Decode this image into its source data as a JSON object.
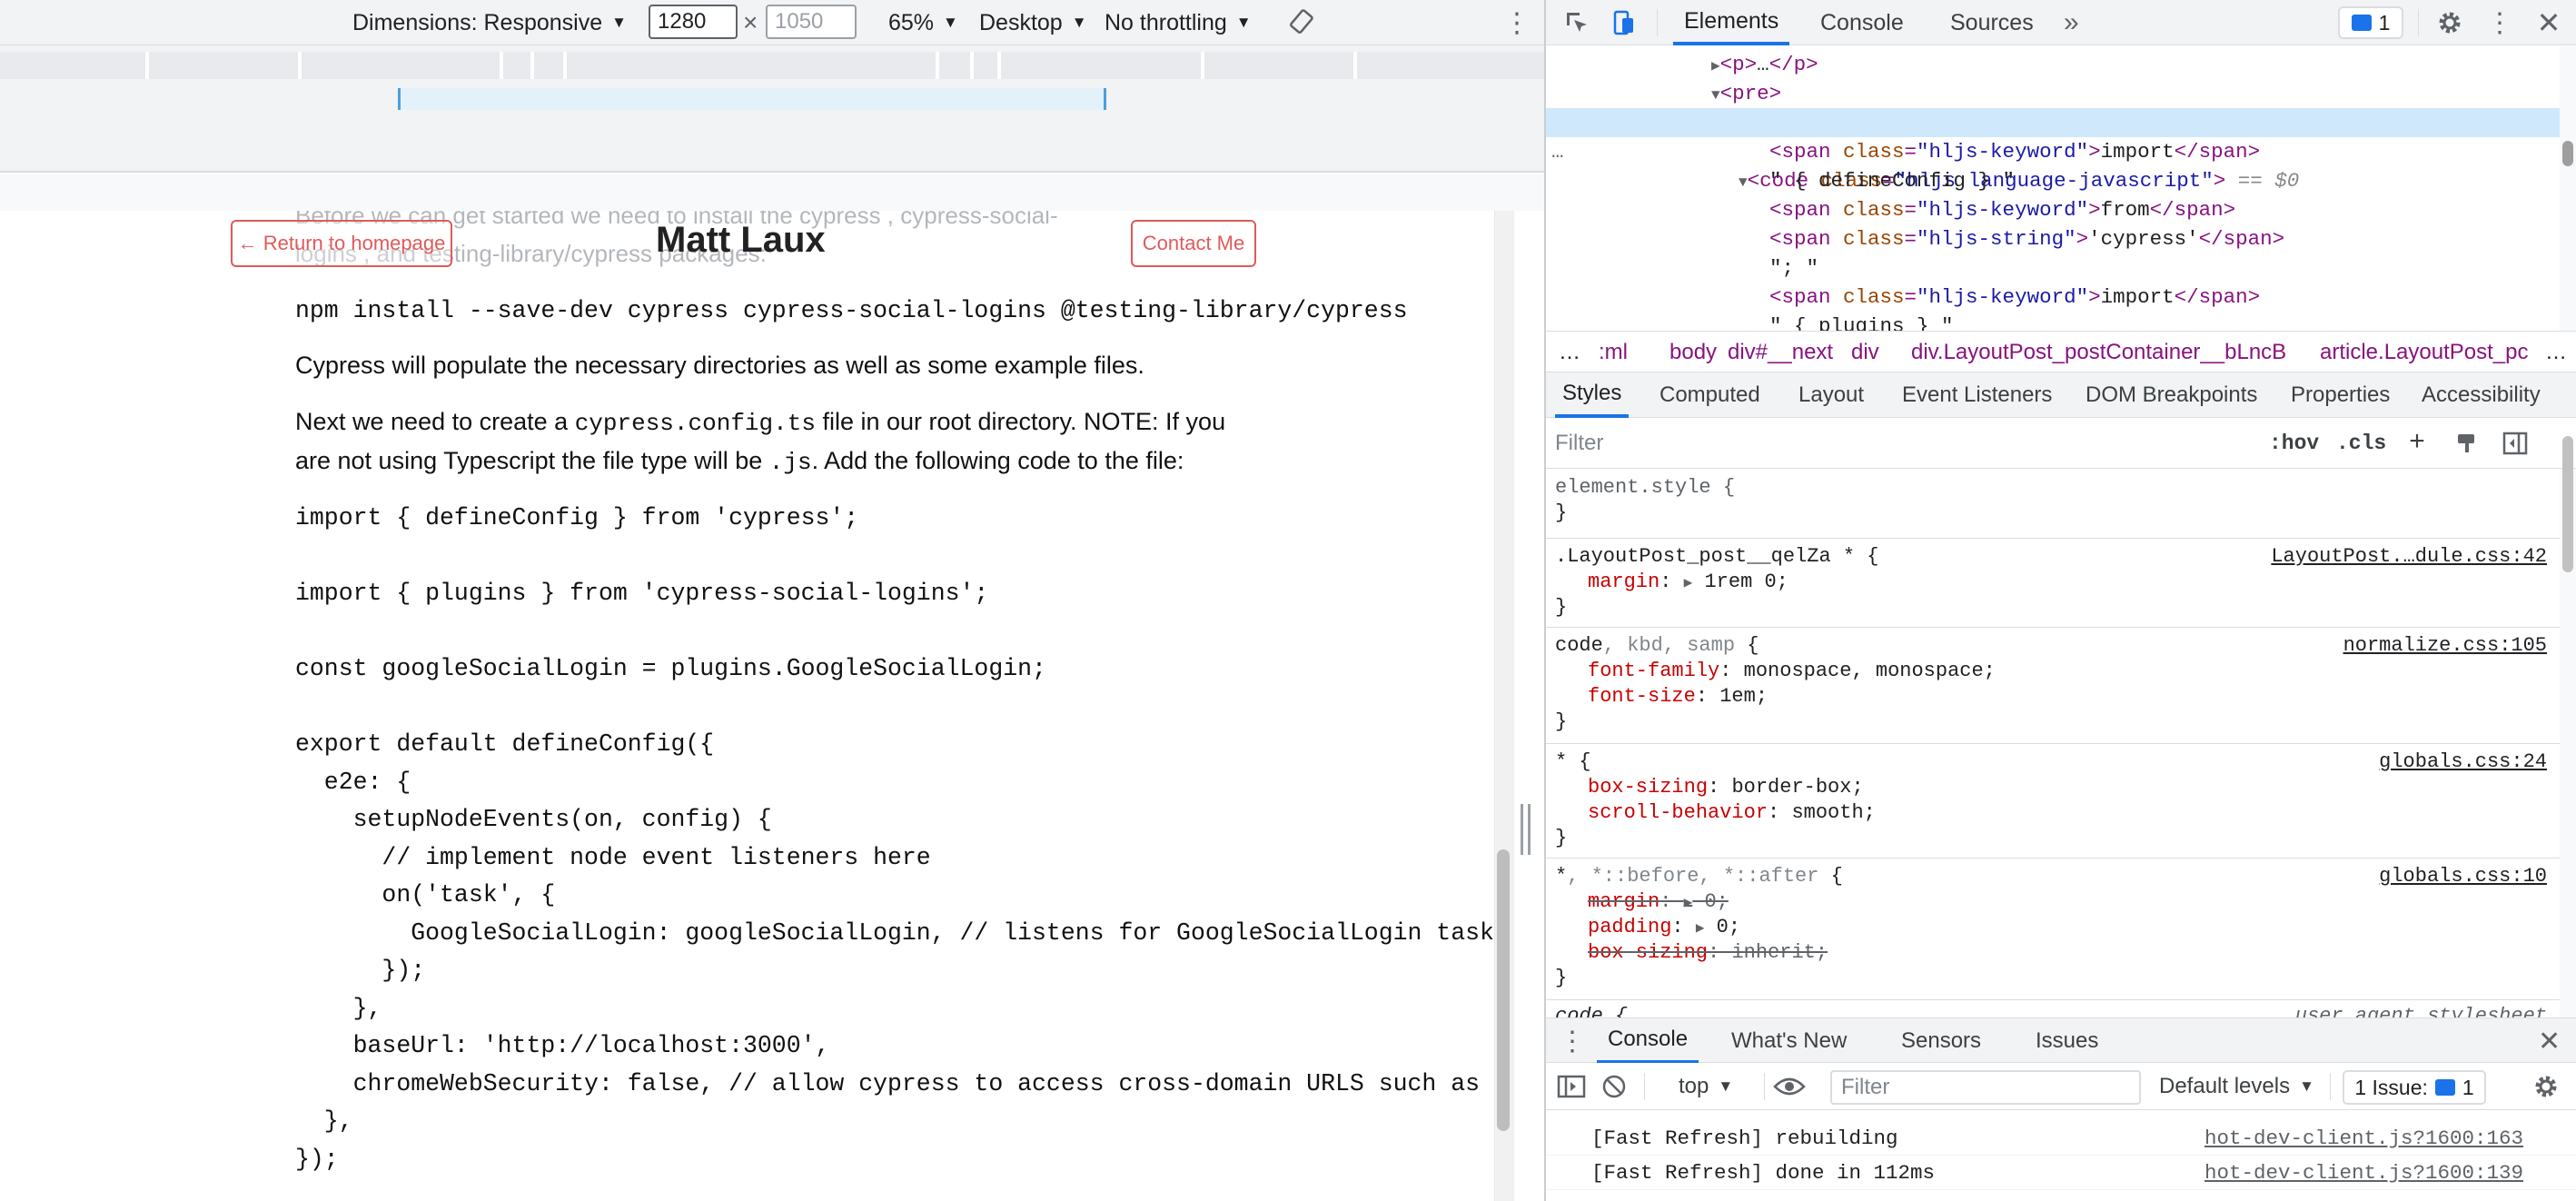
{
  "device_toolbar": {
    "dimensions_label": "Dimensions: Responsive",
    "width": "1280",
    "height_placeholder": "1050",
    "zoom": "65%",
    "device_type": "Desktop",
    "throttling": "No throttling"
  },
  "page": {
    "ghost_line_1": "Before we can get started we need to install the  cypress ,  cypress-social-",
    "ghost_line_2": "logins , and  testing-library/cypress  packages:",
    "return_label": "← Return to homepage",
    "site_title": "Matt Laux",
    "contact_label": "Contact Me",
    "npm_command": "npm install --save-dev cypress cypress-social-logins @testing-library/cypress",
    "para_populate": "Cypress will populate the necessary directories as well as some example files.",
    "para_next_1a": "Next we need to create a ",
    "para_next_1_code": "cypress.config.ts",
    "para_next_1b": " file in our root directory. NOTE: If you",
    "para_next_2a": "are not using Typescript the file type will be ",
    "para_next_2_code": ".js",
    "para_next_2b": ". Add the following code to the file:",
    "code_lines": [
      "import { defineConfig } from 'cypress';",
      "",
      "import { plugins } from 'cypress-social-logins';",
      "",
      "const googleSocialLogin = plugins.GoogleSocialLogin;",
      "",
      "export default defineConfig({",
      "  e2e: {",
      "    setupNodeEvents(on, config) {",
      "      // implement node event listeners here",
      "      on('task', {",
      "        GoogleSocialLogin: googleSocialLogin, // listens for GoogleSocialLogin task i",
      "      });",
      "    },",
      "    baseUrl: 'http://localhost:3000',",
      "    chromeWebSecurity: false, // allow cypress to access cross-domain URLS such as Ne",
      "  },",
      "});"
    ]
  },
  "devtools": {
    "tabs": [
      "Elements",
      "Console",
      "Sources"
    ],
    "more_tabs": "»",
    "message_count": "1",
    "dom": {
      "p_open": "<p>",
      "p_ellipsis": "…",
      "p_close": "</p>",
      "pre_open": "<pre>",
      "code_tag": "<code ",
      "code_attr": "class",
      "code_attr_val": "\"hljs language-javascript\"",
      "code_end": ">",
      "code_eq": " == $0",
      "ellipsis": "…",
      "lines": [
        {
          "pre": "<span ",
          "attr": "class",
          "val": "\"hljs-keyword\"",
          "mid": ">",
          "text": "import",
          "close": "</span>"
        },
        {
          "plain": "\" { defineConfig } \""
        },
        {
          "pre": "<span ",
          "attr": "class",
          "val": "\"hljs-keyword\"",
          "mid": ">",
          "text": "from",
          "close": "</span>"
        },
        {
          "pre": "<span ",
          "attr": "class",
          "val": "\"hljs-string\"",
          "mid": ">",
          "text": "'cypress'",
          "close": "</span>"
        },
        {
          "plain": "\"; \""
        },
        {
          "pre": "<span ",
          "attr": "class",
          "val": "\"hljs-keyword\"",
          "mid": ">",
          "text": "import",
          "close": "</span>"
        },
        {
          "plain": "\" { plugins } \""
        }
      ]
    },
    "breadcrumbs": [
      "…",
      ":ml",
      "body",
      "div#__next",
      "div",
      "div.LayoutPost_postContainer__bLncB",
      "article.LayoutPost_pc"
    ],
    "breadcrumb_more": "…",
    "style_tabs": [
      "Styles",
      "Computed",
      "Layout",
      "Event Listeners",
      "DOM Breakpoints",
      "Properties",
      "Accessibility"
    ],
    "filter_placeholder": "Filter",
    "hov": ":hov",
    "cls": ".cls",
    "plus": "+",
    "rules": [
      {
        "selector": "element.style {",
        "source": "",
        "props": [],
        "close": "}"
      },
      {
        "selector": ".LayoutPost_post__qelZa * {",
        "source": "LayoutPost.…dule.css:42",
        "props": [
          {
            "name": "margin",
            "value": "1rem 0;",
            "arrow": true
          }
        ],
        "close": "}"
      },
      {
        "selector_main": "code",
        "selector_dim": ", kbd, samp",
        "selector_end": " {",
        "source": "normalize.css:105",
        "props": [
          {
            "name": "font-family",
            "value": "monospace, monospace;"
          },
          {
            "name": "font-size",
            "value": "1em;"
          }
        ],
        "close": "}"
      },
      {
        "selector": "* {",
        "source": "globals.css:24",
        "props": [
          {
            "name": "box-sizing",
            "value": "border-box;"
          },
          {
            "name": "scroll-behavior",
            "value": "smooth;"
          }
        ],
        "close": "}"
      },
      {
        "selector_main": "*",
        "selector_dim": ", *::before, *::after",
        "selector_end": " {",
        "source": "globals.css:10",
        "props": [
          {
            "name": "margin",
            "value": "0;",
            "arrow": true,
            "struck": true
          },
          {
            "name": "padding",
            "value": "0;",
            "arrow": true
          },
          {
            "name": "box-sizing",
            "value": "inherit;",
            "struck": true
          }
        ],
        "close": "}"
      },
      {
        "selector": "code {",
        "source": "user agent stylesheet",
        "props": [],
        "close": ""
      }
    ],
    "drawer_tabs": [
      "Console",
      "What's New",
      "Sensors",
      "Issues"
    ],
    "console_context": "top",
    "console_filter_placeholder": "Filter",
    "log_levels": "Default levels",
    "issues_label": "1 Issue:",
    "issues_count": "1",
    "logs": [
      {
        "msg": "[Fast Refresh] rebuilding",
        "src": "hot-dev-client.js?1600:163"
      },
      {
        "msg": "[Fast Refresh] done in 112ms",
        "src": "hot-dev-client.js?1600:139"
      }
    ]
  }
}
